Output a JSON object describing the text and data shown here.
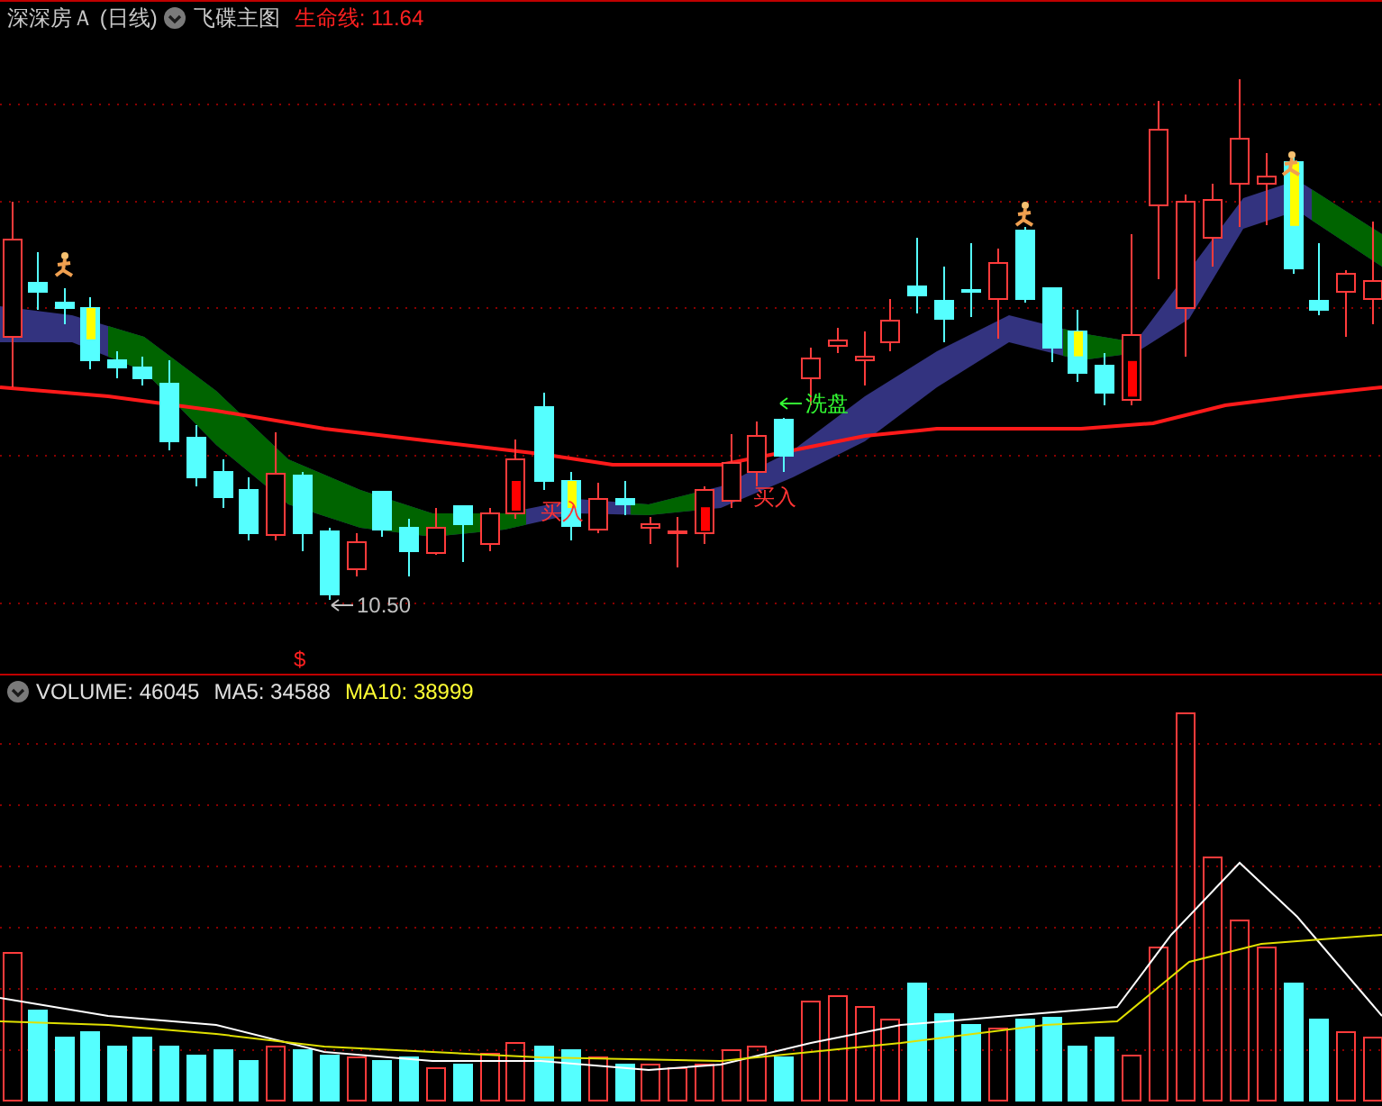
{
  "main_header": {
    "title": "深深房Ａ (日线)",
    "indicator": "飞碟主图",
    "life_line": "生命线: 11.64"
  },
  "annotations": [
    {
      "kind": "wash",
      "text": "洗盘"
    },
    {
      "kind": "buy",
      "text": "买入"
    },
    {
      "kind": "buy",
      "text": "买入"
    },
    {
      "kind": "low",
      "text": "10.50"
    },
    {
      "kind": "marker",
      "text": "$"
    }
  ],
  "volume_header": {
    "volume": "VOLUME: 46045",
    "ma5": "MA5: 34588",
    "ma10": "MA10: 38999"
  }
}
